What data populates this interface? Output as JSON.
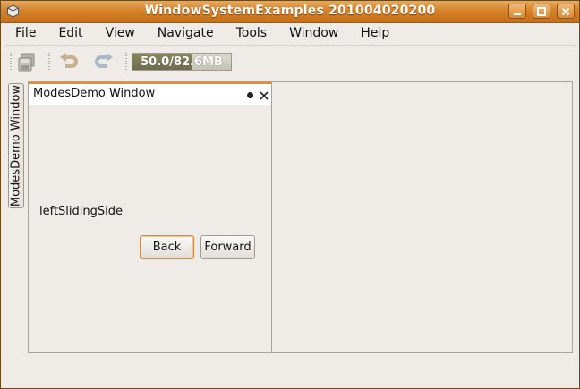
{
  "window": {
    "title": "WindowSystemExamples 201004020200",
    "controls": [
      "minimize-icon",
      "maximize-icon",
      "close-icon"
    ]
  },
  "menubar": {
    "items": [
      {
        "label": "File"
      },
      {
        "label": "Edit"
      },
      {
        "label": "View"
      },
      {
        "label": "Navigate"
      },
      {
        "label": "Tools"
      },
      {
        "label": "Window"
      },
      {
        "label": "Help"
      }
    ]
  },
  "toolbar": {
    "icons": [
      "save-all-icon",
      "undo-icon",
      "redo-icon"
    ],
    "memory": {
      "text": "50.0/82.6MB",
      "used": 50.0,
      "total": 82.6
    }
  },
  "side_tab": {
    "label": "ModesDemo Window"
  },
  "panel": {
    "title": "ModesDemo Window",
    "content_label": "leftSlidingSide",
    "back_label": "Back",
    "forward_label": "Forward"
  },
  "colors": {
    "titlebar": "#d5822b",
    "active_tab_accent": "#e68e2f",
    "background": "#efebe7"
  }
}
